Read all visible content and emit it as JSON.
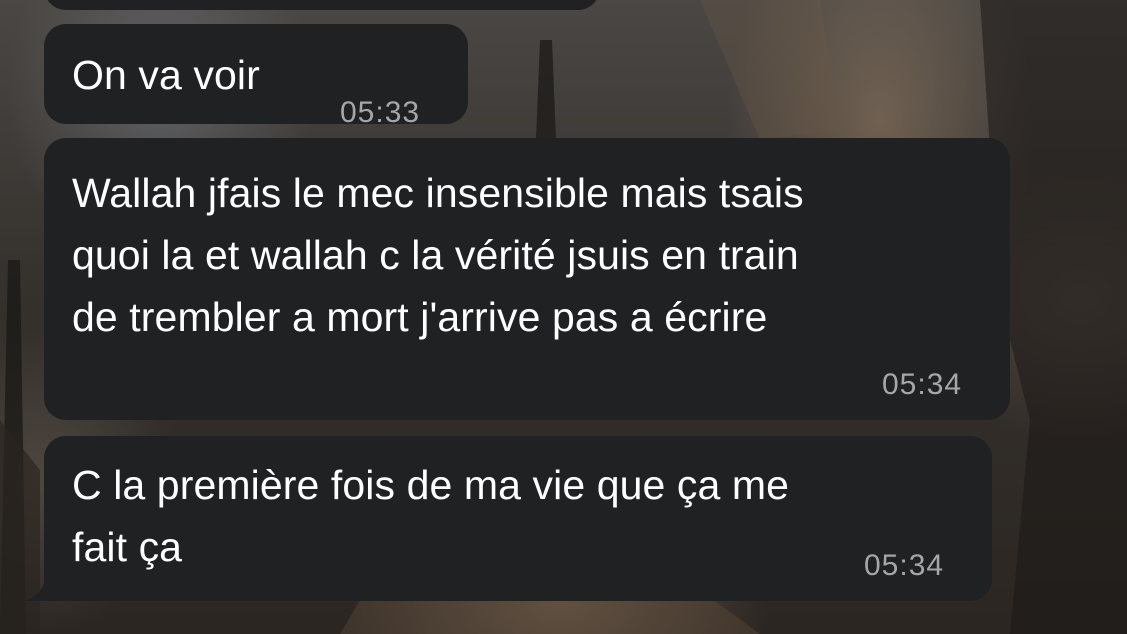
{
  "chat": {
    "messages": [
      {
        "text": "On va voir",
        "time": "05:33"
      },
      {
        "text": "Wallah jfais le mec insensible mais tsais\nquoi la et wallah c la vérité jsuis en train\nde trembler a mort j'arrive pas a écrire",
        "time": "05:34"
      },
      {
        "text": "C la première fois de ma vie que ça me\nfait ça",
        "time": "05:34"
      }
    ]
  },
  "colors": {
    "bubble_background": "#202122",
    "message_text": "#ffffff",
    "timestamp_text": "#a6a6a6"
  }
}
